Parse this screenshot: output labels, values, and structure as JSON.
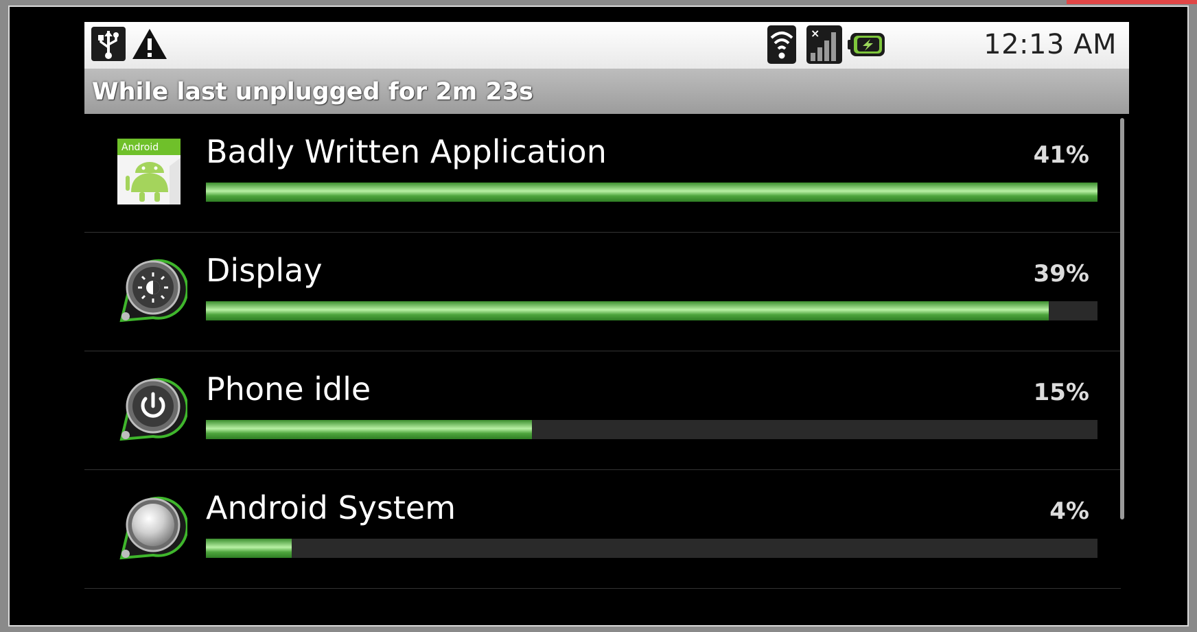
{
  "status_bar": {
    "time": "12:13 AM",
    "left_icons": [
      "usb-debug-icon",
      "warning-icon"
    ],
    "right_icons": [
      "wifi-icon",
      "signal-icon",
      "battery-charging-icon"
    ]
  },
  "header": {
    "title": "While last unplugged for 2m 23s"
  },
  "list": {
    "items": [
      {
        "label": "Badly Written Application",
        "percent_text": "41%",
        "usage": 1.0,
        "icon": "android-app-icon"
      },
      {
        "label": "Display",
        "percent_text": "39%",
        "usage": 0.945,
        "icon": "display-brightness-icon"
      },
      {
        "label": "Phone idle",
        "percent_text": "15%",
        "usage": 0.366,
        "icon": "power-icon"
      },
      {
        "label": "Android System",
        "percent_text": "4%",
        "usage": 0.096,
        "icon": "android-system-icon"
      }
    ]
  },
  "colors": {
    "accent": "#3fb62c",
    "bar_track": "#2a2a2a",
    "header_bg": "#a8a8a8"
  }
}
